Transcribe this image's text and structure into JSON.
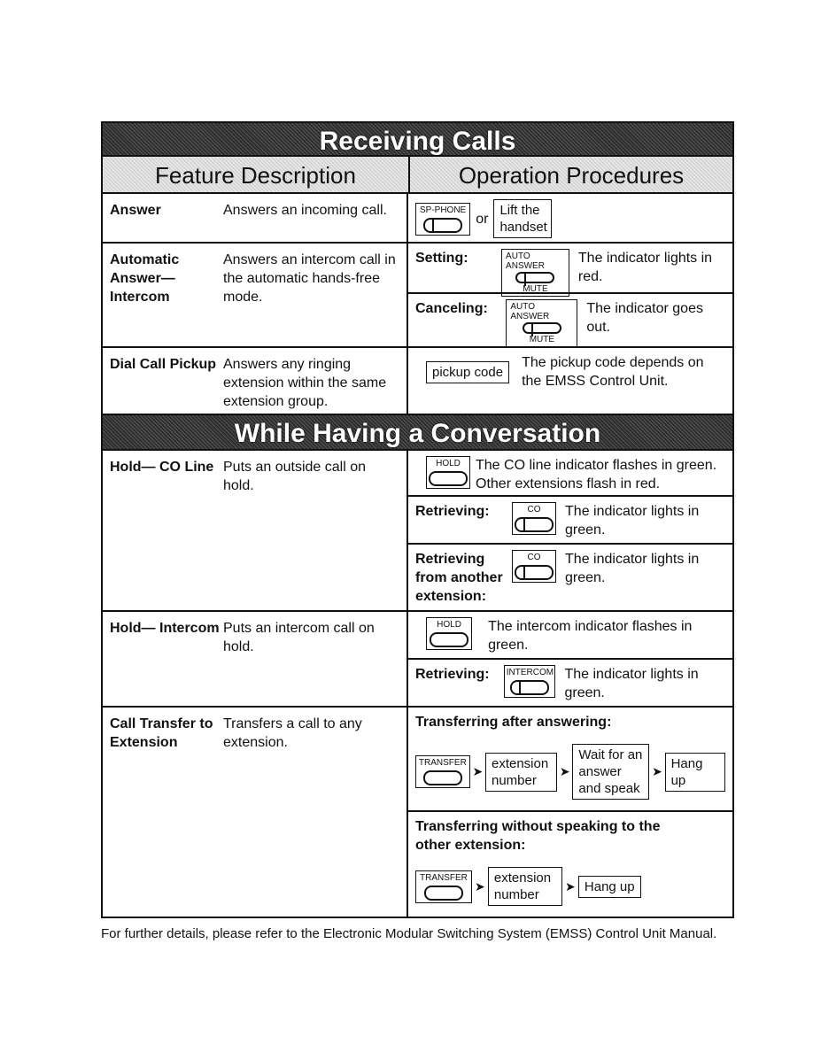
{
  "sections": {
    "receiving": "Receiving Calls",
    "conversation": "While Having a Conversation"
  },
  "headers": {
    "feature": "Feature Description",
    "operation": "Operation Procedures"
  },
  "rows": {
    "answer": {
      "name": "Answer",
      "desc": "Answers an incoming call.",
      "key": "SP-PHONE",
      "or": "or",
      "alt": "Lift the handset"
    },
    "auto_answer": {
      "name": "Automatic Answer— Intercom",
      "desc": "Answers an intercom call in the automatic hands-free mode.",
      "setting_label": "Setting:",
      "setting_text": "The indicator lights in red.",
      "canceling_label": "Canceling:",
      "canceling_text": "The indicator goes out.",
      "key_top": "AUTO ANSWER",
      "key_bottom": "MUTE"
    },
    "dial_pickup": {
      "name": "Dial Call Pickup",
      "desc": "Answers any ringing extension within the same extension group.",
      "box": "pickup code",
      "text": "The pickup code depends on the EMSS Control Unit."
    },
    "hold_co": {
      "name": "Hold— CO Line",
      "desc": "Puts an outside call on hold.",
      "key": "HOLD",
      "text": "The CO line indicator flashes in green. Other extensions flash in red.",
      "retrieving_label": "Retrieving:",
      "retrieving_key": "CO",
      "retrieving_text": "The indicator lights in green.",
      "retrieving_other_label": "Retrieving from another extension:",
      "retrieving_other_key": "CO",
      "retrieving_other_text": "The indicator lights in green."
    },
    "hold_intercom": {
      "name": "Hold— Intercom",
      "desc": "Puts an intercom call on hold.",
      "key": "HOLD",
      "text": "The intercom indicator flashes in green.",
      "retrieving_label": "Retrieving:",
      "retrieving_key": "INTERCOM",
      "retrieving_text": "The indicator lights in green."
    },
    "transfer": {
      "name": "Call Transfer to Extension",
      "desc": "Transfers a call to any extension.",
      "after_label": "Transferring after answering:",
      "without_label": "Transferring without speaking to the other extension:",
      "key": "TRANSFER",
      "step_ext": "extension number",
      "step_wait": "Wait for an answer and speak",
      "step_hang": "Hang up"
    }
  },
  "footer": "For further details, please refer to the Electronic Modular Switching System (EMSS) Control Unit Manual."
}
